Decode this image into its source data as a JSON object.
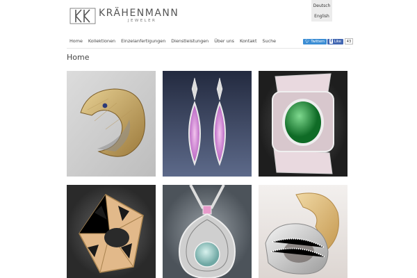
{
  "lang": {
    "de": "Deutsch",
    "en": "English"
  },
  "brand": {
    "name": "KRÄHENMANN",
    "tagline": "JEWELER"
  },
  "nav": {
    "items": [
      "Home",
      "Kollektionen",
      "Einzelanfertigungen",
      "Dienstleistungen",
      "Über uns",
      "Kontakt",
      "Suche"
    ]
  },
  "share": {
    "twitter": "Twittern",
    "facebook": "Like",
    "count": "43"
  },
  "page": {
    "title": "Home"
  },
  "colors": {
    "twitter": "#3b8dd4",
    "facebook": "#4267b2",
    "rule": "#e6e6e6"
  }
}
